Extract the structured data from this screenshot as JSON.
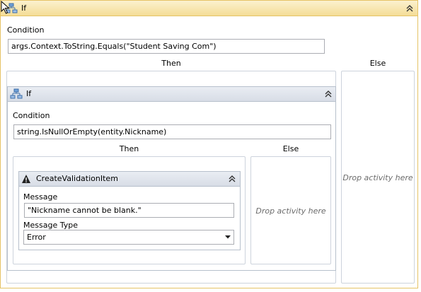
{
  "outer_if": {
    "title": "If",
    "condition_label": "Condition",
    "condition_value": "args.Context.ToString.Equals(\"Student Saving Com\")",
    "then_label": "Then",
    "else_label": "Else",
    "else_drop": "Drop activity here"
  },
  "inner_if": {
    "title": "If",
    "condition_label": "Condition",
    "condition_value": "string.IsNullOrEmpty(entity.Nickname)",
    "then_label": "Then",
    "else_label": "Else",
    "else_drop": "Drop activity here"
  },
  "validation": {
    "title": "CreateValidationItem",
    "message_label": "Message",
    "message_value": "\"Nickname cannot be blank.\"",
    "type_label": "Message Type",
    "type_value": "Error"
  },
  "icons": {
    "if": "flowchart-branch-icon",
    "warning": "warning-icon",
    "collapse": "double-chevron-up-icon",
    "dropdown": "dropdown-arrow-icon"
  }
}
